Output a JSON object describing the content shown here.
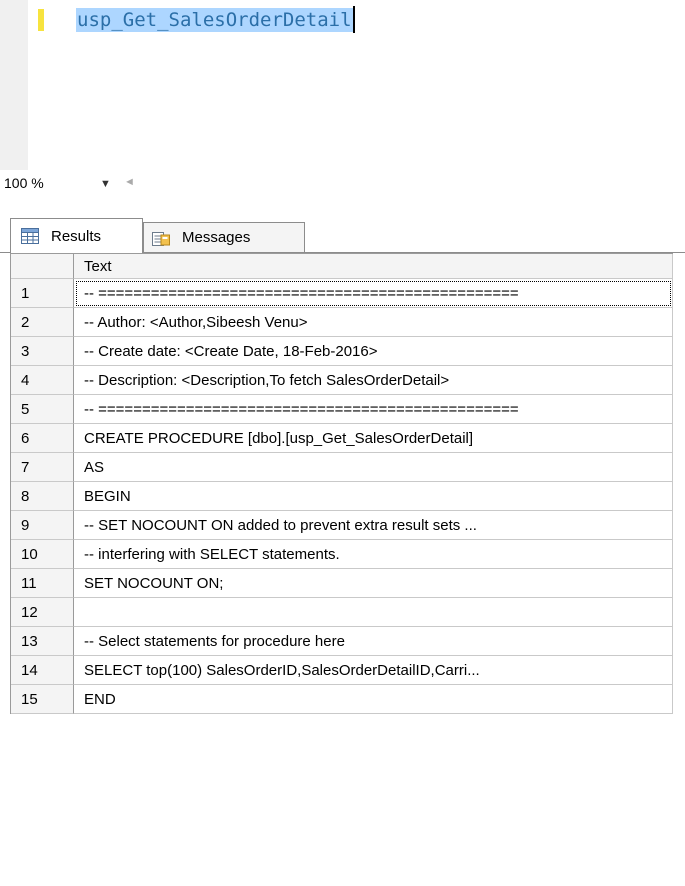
{
  "editor": {
    "code_line": "usp_Get_SalesOrderDetail"
  },
  "zoom": {
    "value": "100 %"
  },
  "tabs": [
    {
      "label": "Results",
      "icon": "grid-icon",
      "selected": true
    },
    {
      "label": "Messages",
      "icon": "messages-icon",
      "selected": false
    }
  ],
  "grid": {
    "column_header": "Text",
    "rows": [
      {
        "num": "1",
        "text": "-- ================================================"
      },
      {
        "num": "2",
        "text": "-- Author:  <Author,Sibeesh Venu>"
      },
      {
        "num": "3",
        "text": "-- Create date: <Create Date, 18-Feb-2016>"
      },
      {
        "num": "4",
        "text": "-- Description: <Description,To fetch SalesOrderDetail>"
      },
      {
        "num": "5",
        "text": "-- ================================================"
      },
      {
        "num": "6",
        "text": "CREATE PROCEDURE [dbo].[usp_Get_SalesOrderDetail]"
      },
      {
        "num": "7",
        "text": "AS"
      },
      {
        "num": "8",
        "text": "BEGIN"
      },
      {
        "num": "9",
        "text": " -- SET NOCOUNT ON added to prevent extra result sets ..."
      },
      {
        "num": "10",
        "text": " -- interfering with SELECT statements."
      },
      {
        "num": "11",
        "text": " SET NOCOUNT ON;"
      },
      {
        "num": "12",
        "text": ""
      },
      {
        "num": "13",
        "text": "    -- Select statements for procedure here"
      },
      {
        "num": "14",
        "text": " SELECT top(100) SalesOrderID,SalesOrderDetailID,Carri..."
      },
      {
        "num": "15",
        "text": "END"
      }
    ]
  },
  "colors": {
    "selection": "#add6ff",
    "code_text": "#2b6fa8",
    "change_marker": "#f7e33e"
  }
}
